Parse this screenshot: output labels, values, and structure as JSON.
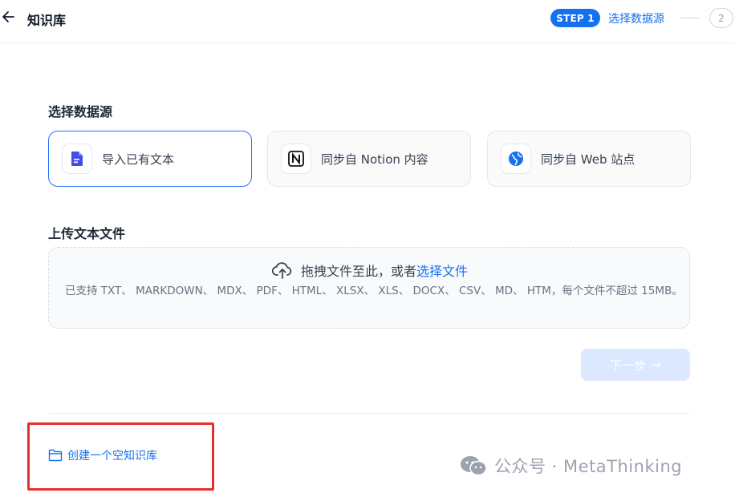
{
  "header": {
    "title": "知识库",
    "step1_badge": "STEP 1",
    "step1_label": "选择数据源",
    "step2_number": "2"
  },
  "datasource": {
    "title": "选择数据源",
    "options": [
      {
        "label": "导入已有文本",
        "icon": "document-icon",
        "selected": true
      },
      {
        "label": "同步自 Notion 内容",
        "icon": "notion-logo-icon",
        "selected": false
      },
      {
        "label": "同步自 Web 站点",
        "icon": "web-globe-icon",
        "selected": false
      }
    ]
  },
  "upload": {
    "title": "上传文本文件",
    "drag_text": "拖拽文件至此，或者 ",
    "select_link": "选择文件",
    "hint": "已支持 TXT、 MARKDOWN、 MDX、 PDF、 HTML、 XLSX、 XLS、 DOCX、 CSV、 MD、 HTM，每个文件不超过 15MB。"
  },
  "next_button": {
    "label": "下一步",
    "arrow": "→"
  },
  "create_empty": {
    "label": "创建一个空知识库"
  },
  "watermark": {
    "text": "公众号 · MetaThinking"
  },
  "colors": {
    "accent": "#1570ef",
    "highlight": "#e52e2e",
    "disabled_button": "#dbe8ff"
  }
}
